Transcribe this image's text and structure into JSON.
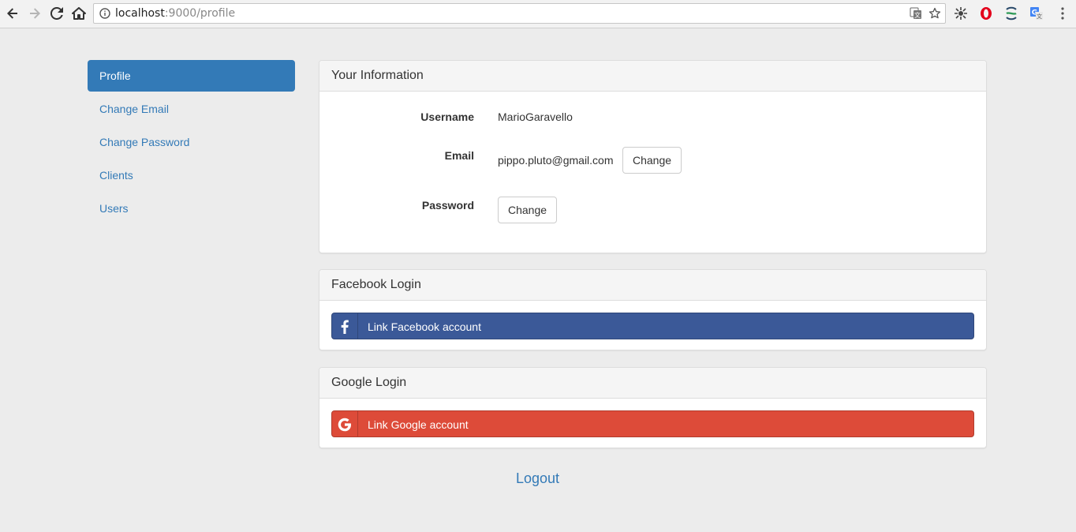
{
  "browser": {
    "url_host": "localhost",
    "url_rest": ":9000/profile"
  },
  "sidebar": {
    "items": [
      {
        "label": "Profile",
        "active": true
      },
      {
        "label": "Change Email"
      },
      {
        "label": "Change Password"
      },
      {
        "label": "Clients"
      },
      {
        "label": "Users"
      }
    ]
  },
  "info_panel": {
    "title": "Your Information",
    "username_label": "Username",
    "username_value": "MarioGaravello",
    "email_label": "Email",
    "email_value": "pippo.pluto@gmail.com",
    "email_change": "Change",
    "password_label": "Password",
    "password_change": "Change"
  },
  "facebook_panel": {
    "title": "Facebook Login",
    "button": "Link Facebook account"
  },
  "google_panel": {
    "title": "Google Login",
    "button": "Link Google account"
  },
  "logout": "Logout",
  "colors": {
    "primary": "#337ab7",
    "facebook": "#3b5998",
    "google": "#dd4b39",
    "background": "#ececec"
  },
  "icons": [
    "back-arrow-icon",
    "forward-arrow-icon",
    "reload-icon",
    "home-icon",
    "info-icon",
    "translate-icon",
    "star-icon",
    "extension-icon",
    "opera-icon",
    "extension-swirl-icon",
    "google-translate-icon",
    "menu-dots-icon",
    "facebook-icon",
    "google-icon"
  ]
}
